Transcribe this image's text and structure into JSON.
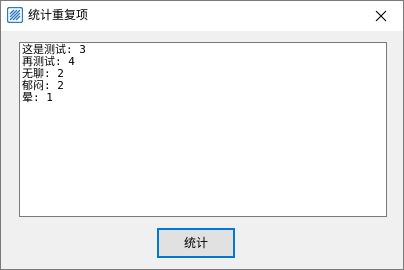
{
  "window": {
    "title": "统计重复项",
    "icon": "app-window-icon",
    "close_icon": "close-icon"
  },
  "output": {
    "lines": [
      "这是测试: 3",
      "再测试: 4",
      "无聊: 2",
      "郁闷: 2",
      "晕: 1"
    ]
  },
  "actions": {
    "count_label": "统计"
  },
  "colors": {
    "accent": "#0078d7",
    "window_bg": "#f0f0f0",
    "icon_blue": "#2e7bbf"
  }
}
